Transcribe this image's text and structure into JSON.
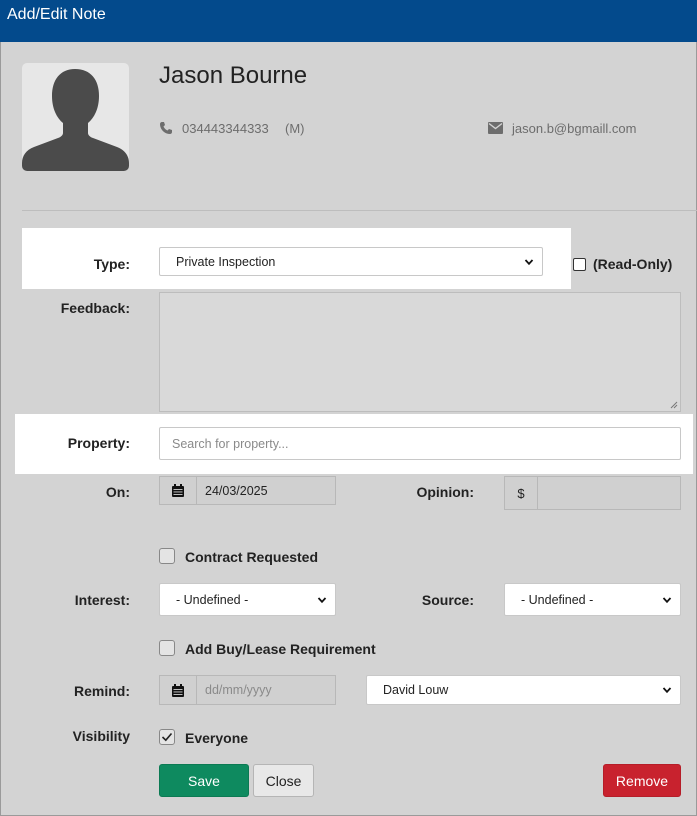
{
  "window": {
    "title": "Add/Edit Note"
  },
  "contact": {
    "name": "Jason Bourne",
    "phone": "034443344333",
    "phone_type": "(M)",
    "email": "jason.b@bgmaill.com"
  },
  "form": {
    "type_label": "Type:",
    "type_value": "Private Inspection",
    "readonly_label": "(Read-Only)",
    "readonly_checked": false,
    "feedback_label": "Feedback:",
    "feedback_value": "",
    "property_label": "Property:",
    "property_placeholder": "Search for property...",
    "on_label": "On:",
    "on_date": "24/03/2025",
    "opinion_label": "Opinion:",
    "opinion_currency": "$",
    "opinion_value": "",
    "contract_label": "Contract Requested",
    "contract_checked": false,
    "interest_label": "Interest:",
    "interest_value": "- Undefined -",
    "source_label": "Source:",
    "source_value": "- Undefined -",
    "buylease_label": "Add Buy/Lease Requirement",
    "buylease_checked": false,
    "remind_label": "Remind:",
    "remind_placeholder": "dd/mm/yyyy",
    "remind_user": "David Louw",
    "visibility_label": "Visibility",
    "visibility_option": "Everyone",
    "visibility_checked": true
  },
  "buttons": {
    "save": "Save",
    "close": "Close",
    "remove": "Remove"
  },
  "colors": {
    "titlebar": "#034a8c",
    "save": "#0e8a5f",
    "remove": "#c8222e",
    "background": "#d3d3d3"
  },
  "icons": [
    "avatar-silhouette",
    "phone-icon",
    "mail-icon",
    "calendar-icon",
    "chevron-down-icon",
    "check-icon"
  ]
}
